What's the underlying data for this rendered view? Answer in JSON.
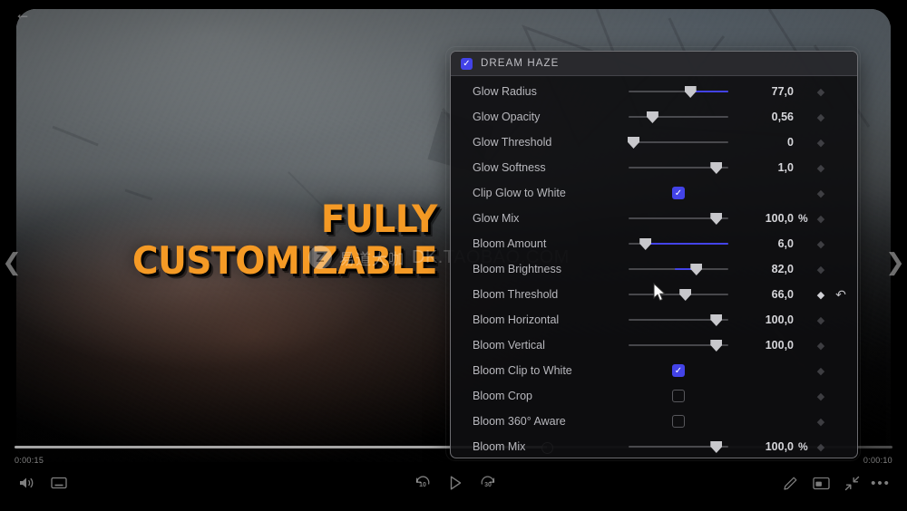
{
  "player": {
    "back_arrow_icon": "back-arrow-icon",
    "prev_chevron_icon": "chevron-left-icon",
    "next_chevron_icon": "chevron-right-icon",
    "time_elapsed": "0:00:15",
    "time_remaining": "0:00:10",
    "controls": {
      "volume_icon": "volume-icon",
      "captions_icon": "closed-captions-icon",
      "rewind_label": "10",
      "rewind_icon": "rewind-10-icon",
      "play_icon": "play-icon",
      "forward_label": "30",
      "forward_icon": "forward-30-icon",
      "edit_icon": "pencil-edit-icon",
      "pip_icon": "picture-in-picture-icon",
      "shrink_icon": "shrink-screen-icon",
      "more_icon": "more-options-icon",
      "more_label": "•••"
    }
  },
  "overlay": {
    "headline_line1": "FULLY",
    "headline_line2": "CUSTOMIZABLE",
    "headline_color": "#F59A25",
    "watermark_badge": "Z",
    "watermark_cjk": "易道大咖",
    "watermark_url": "DK.TAOBAO.COM"
  },
  "panel": {
    "title": "DREAM HAZE",
    "enabled": true,
    "accent_color": "#4343E8",
    "rows": [
      {
        "label": "Glow Radius",
        "type": "slider",
        "value": "77,0",
        "unit": "",
        "handle_pct": 62,
        "fill": {
          "from_pct": 62,
          "to_pct": 100
        },
        "keyframe": false,
        "reset": false
      },
      {
        "label": "Glow Opacity",
        "type": "slider",
        "value": "0,56",
        "unit": "",
        "handle_pct": 24,
        "fill": null,
        "keyframe": false,
        "reset": false
      },
      {
        "label": "Glow Threshold",
        "type": "slider",
        "value": "0",
        "unit": "",
        "handle_pct": 5,
        "fill": null,
        "keyframe": false,
        "reset": false
      },
      {
        "label": "Glow Softness",
        "type": "slider",
        "value": "1,0",
        "unit": "",
        "handle_pct": 88,
        "fill": null,
        "keyframe": false,
        "reset": false
      },
      {
        "label": "Clip Glow to White",
        "type": "checkbox",
        "checked": true,
        "keyframe": false,
        "reset": false
      },
      {
        "label": "Glow Mix",
        "type": "slider",
        "value": "100,0",
        "unit": "%",
        "handle_pct": 88,
        "fill": null,
        "keyframe": false,
        "reset": false
      },
      {
        "label": "Bloom Amount",
        "type": "slider",
        "value": "6,0",
        "unit": "",
        "handle_pct": 17,
        "fill": {
          "from_pct": 17,
          "to_pct": 100
        },
        "keyframe": false,
        "reset": false
      },
      {
        "label": "Bloom Brightness",
        "type": "slider",
        "value": "82,0",
        "unit": "",
        "handle_pct": 68,
        "fill": {
          "from_pct": 46,
          "to_pct": 68
        },
        "keyframe": false,
        "reset": false
      },
      {
        "label": "Bloom Threshold",
        "type": "slider",
        "value": "66,0",
        "unit": "",
        "handle_pct": 57,
        "fill": null,
        "keyframe": true,
        "reset": true
      },
      {
        "label": "Bloom Horizontal",
        "type": "slider",
        "value": "100,0",
        "unit": "",
        "handle_pct": 88,
        "fill": null,
        "keyframe": false,
        "reset": false
      },
      {
        "label": "Bloom Vertical",
        "type": "slider",
        "value": "100,0",
        "unit": "",
        "handle_pct": 88,
        "fill": null,
        "keyframe": false,
        "reset": false
      },
      {
        "label": "Bloom Clip to White",
        "type": "checkbox",
        "checked": true,
        "keyframe": false,
        "reset": false
      },
      {
        "label": "Bloom Crop",
        "type": "checkbox",
        "checked": false,
        "keyframe": false,
        "reset": false
      },
      {
        "label": "Bloom 360° Aware",
        "type": "checkbox",
        "checked": false,
        "keyframe": false,
        "reset": false
      },
      {
        "label": "Bloom Mix",
        "type": "slider",
        "value": "100,0",
        "unit": "%",
        "handle_pct": 88,
        "fill": null,
        "keyframe": false,
        "reset": false
      }
    ]
  }
}
